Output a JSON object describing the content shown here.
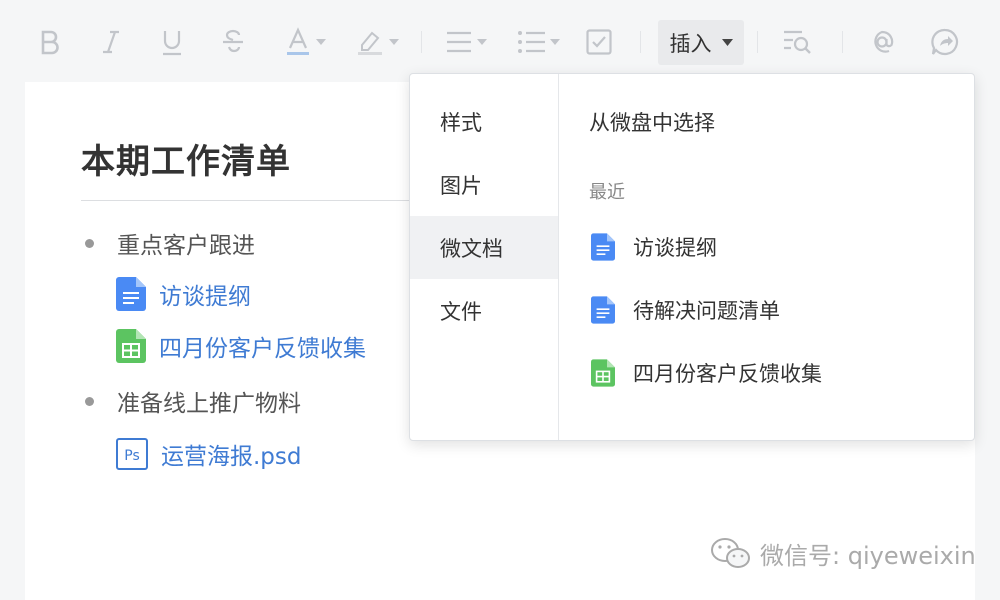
{
  "toolbar": {
    "insert_label": "插入",
    "icons": [
      "bold-icon",
      "italic-icon",
      "underline-icon",
      "strikethrough-icon",
      "font-color-icon",
      "highlight-icon",
      "align-icon",
      "list-icon",
      "checkbox-icon",
      "find-replace-icon",
      "mention-icon",
      "share-icon"
    ]
  },
  "document": {
    "title": "本期工作清单",
    "items": [
      {
        "label": "重点客户跟进",
        "attachments": [
          {
            "name": "访谈提纲",
            "type": "doc"
          },
          {
            "name": "四月份客户反馈收集",
            "type": "sheet"
          }
        ]
      },
      {
        "label": "准备线上推广物料",
        "attachments": [
          {
            "name": "运营海报.psd",
            "type": "psd"
          }
        ]
      }
    ]
  },
  "insert_menu": {
    "categories": [
      "样式",
      "图片",
      "微文档",
      "文件"
    ],
    "active_category": "微文档",
    "pick_from_drive": "从微盘中选择",
    "recent_label": "最近",
    "recent_files": [
      {
        "name": "访谈提纲",
        "type": "doc"
      },
      {
        "name": "待解决问题清单",
        "type": "doc"
      },
      {
        "name": "四月份客户反馈收集",
        "type": "sheet"
      }
    ]
  },
  "watermark": {
    "text": "微信号: qiyeweixin"
  },
  "colors": {
    "link": "#3f7bd3",
    "doc_icon": "#4a8af4",
    "sheet_icon": "#5cc461",
    "psd_icon": "#3f7bd3",
    "toolbar_icon": "#c2c5ca"
  }
}
